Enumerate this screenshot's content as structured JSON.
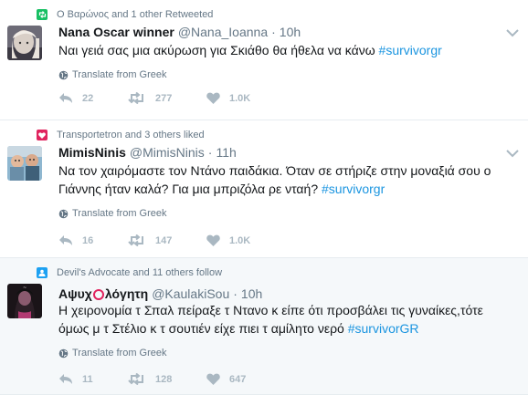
{
  "tweets": [
    {
      "context": "Ο Βαρώνος and 1 other Retweeted",
      "context_icon": "retweet-icon",
      "context_color": "#17bf63",
      "name": "Nana Oscar winner",
      "handle": "@Nana_Ioanna",
      "time": "10h",
      "text": "Ναι γειά σας μια ακύρωση για Σκιάθο θα ήθελα να κάνω ",
      "hashtag": "#survivorgr",
      "translate": "Translate from Greek",
      "replies": "22",
      "retweets": "277",
      "likes": "1.0K"
    },
    {
      "context": "Transportetron and 3 others liked",
      "context_icon": "heart-icon",
      "context_color": "#e0245e",
      "name": "MimisNinis",
      "handle": "@MimisNinis",
      "time": "11h",
      "text": "Να τον χαιρόμαστε τον Ντάνο παιδάκια. Όταν σε στήριζε στην μοναξιά σου ο Γιάννης ήταν καλά?  Για μια μπριζόλα ρε νταή? ",
      "hashtag": "#survivorgr",
      "translate": "Translate from Greek",
      "replies": "16",
      "retweets": "147",
      "likes": "1.0K"
    },
    {
      "context": "Devil's Advocate and 11 others follow",
      "context_icon": "follow-icon",
      "context_color": "#1da1f2",
      "name_part1": "Αψυχ",
      "name_part2": "λόγητη",
      "handle": "@KaulakiSou",
      "time": "10h",
      "text": "Η χειρονομία τ Σπαλ πείραξε τ Ντανο κ είπε ότι προσβάλει τις γυναίκες,τότε όμως μ τ Στέλιο κ τ σουτιέν είχε πιει τ αμίλητο νερό ",
      "hashtag": "#survivorGR",
      "translate": "Translate from Greek",
      "replies": "11",
      "retweets": "128",
      "likes": "647"
    }
  ]
}
